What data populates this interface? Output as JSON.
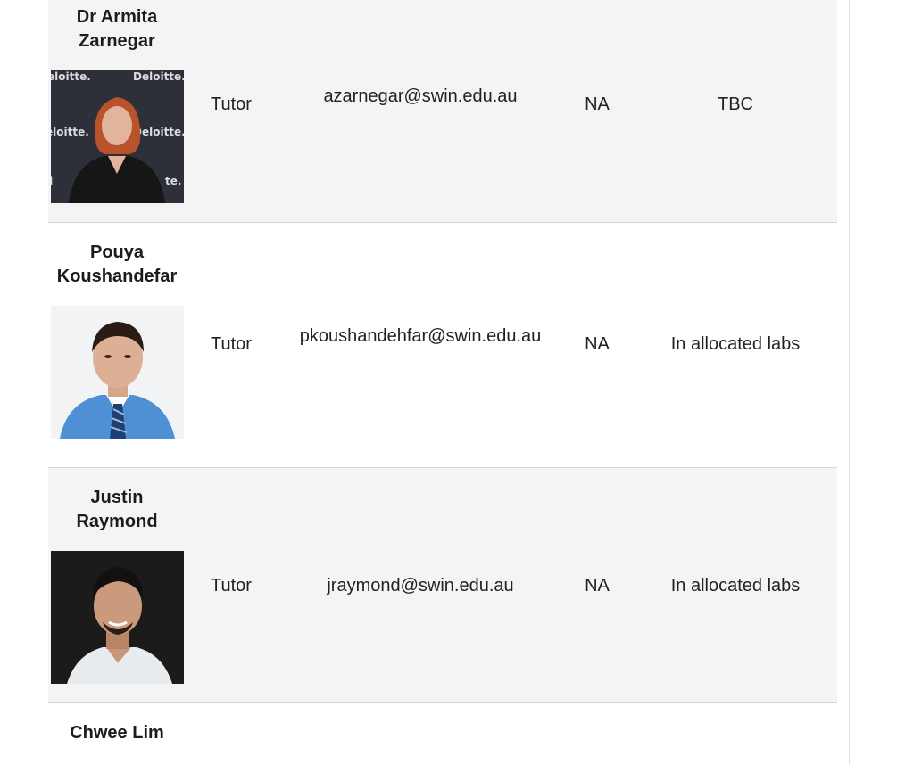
{
  "staff": [
    {
      "name": "Dr Armita Zarnegar",
      "name_lines": [
        "Dr Armita",
        "Zarnegar"
      ],
      "photo": "portrait-woman-deloitte-backdrop",
      "role": "Tutor",
      "email": "azarnegar@swin.edu.au",
      "phone": "NA",
      "consultation": "TBC"
    },
    {
      "name": "Pouya Koushandefar",
      "name_lines": [
        "Pouya",
        "Koushandefar"
      ],
      "photo": "portrait-man-blue-shirt-tie",
      "role": "Tutor",
      "email": "pkoushandehfar@swin.edu.au",
      "phone": "NA",
      "consultation": "In allocated labs"
    },
    {
      "name": "Justin Raymond",
      "name_lines": [
        "Justin",
        "Raymond"
      ],
      "photo": "portrait-man-smiling-dark-background",
      "role": "Tutor",
      "email": "jraymond@swin.edu.au",
      "phone": "NA",
      "consultation": "In allocated labs"
    },
    {
      "name": "Chwee Lim",
      "name_lines": [
        "Chwee Lim"
      ],
      "photo": "portrait-partially-visible"
    }
  ],
  "colors": {
    "row_shaded": "#f4f4f4",
    "row_plain": "#ffffff",
    "row_divider": "#d6d6d6",
    "text": "#222222"
  }
}
